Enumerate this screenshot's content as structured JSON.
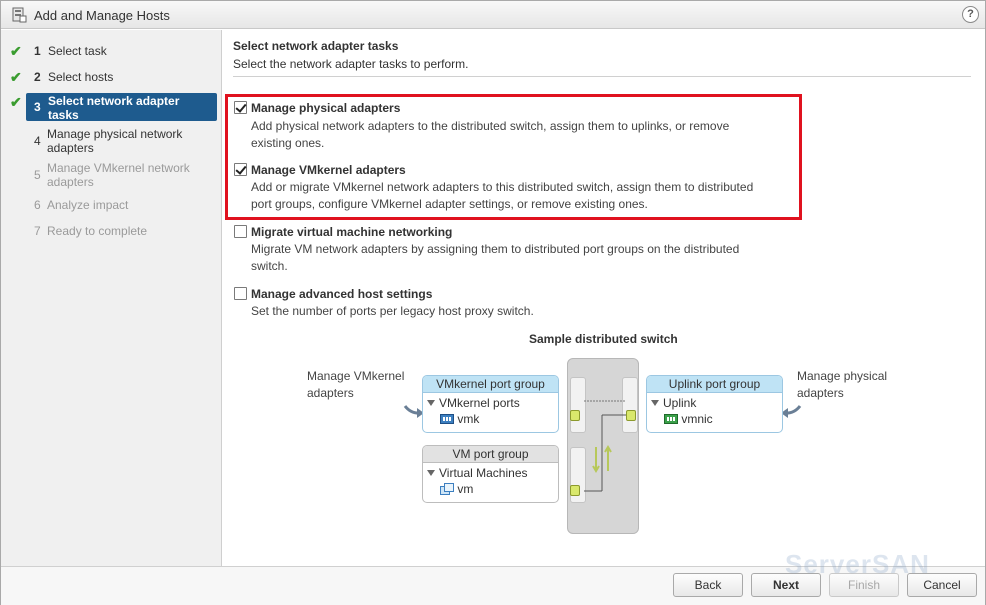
{
  "window": {
    "title": "Add and Manage Hosts",
    "help": "?"
  },
  "steps": [
    {
      "num": "1",
      "label": "Select task",
      "state": "done"
    },
    {
      "num": "2",
      "label": "Select hosts",
      "state": "done"
    },
    {
      "num": "3",
      "label": "Select network adapter tasks",
      "state": "active"
    },
    {
      "num": "4",
      "label": "Manage physical network adapters",
      "state": "enabled"
    },
    {
      "num": "5",
      "label": "Manage VMkernel network adapters",
      "state": "disabled"
    },
    {
      "num": "6",
      "label": "Analyze impact",
      "state": "disabled"
    },
    {
      "num": "7",
      "label": "Ready to complete",
      "state": "disabled"
    }
  ],
  "page": {
    "title": "Select network adapter tasks",
    "subtitle": "Select the network adapter tasks to perform."
  },
  "options": [
    {
      "label": "Manage physical adapters",
      "checked": true,
      "desc1": "Add physical network adapters to the distributed switch, assign them to uplinks, or remove",
      "desc2": "existing ones."
    },
    {
      "label": "Manage VMkernel adapters",
      "checked": true,
      "desc1": "Add or migrate VMkernel network adapters to this distributed switch, assign them to distributed",
      "desc2": "port groups, configure VMkernel adapter settings, or remove existing ones."
    },
    {
      "label": "Migrate virtual machine networking",
      "checked": false,
      "desc1": "Migrate VM network adapters by assigning them to distributed port groups on the distributed",
      "desc2": "switch."
    },
    {
      "label": "Manage advanced host settings",
      "checked": false,
      "desc1": "Set the number of ports per legacy host proxy switch.",
      "desc2": ""
    }
  ],
  "diagram": {
    "title": "Sample distributed switch",
    "left_label1": "Manage VMkernel",
    "left_label2": "adapters",
    "right_label1": "Manage physical",
    "right_label2": "adapters",
    "vmk_group": {
      "header": "VMkernel port group",
      "item": "VMkernel ports",
      "leaf": "vmk"
    },
    "vm_group": {
      "header": "VM port group",
      "item": "Virtual Machines",
      "leaf": "vm"
    },
    "uplink_group": {
      "header": "Uplink port group",
      "item": "Uplink",
      "leaf": "vmnic"
    }
  },
  "footer": {
    "back": "Back",
    "next": "Next",
    "finish": "Finish",
    "cancel": "Cancel"
  },
  "watermark": "ServerSAN",
  "colors": {
    "accent": "#1e5b8e",
    "check": "#3a9c2f",
    "highlight": "#e0121f"
  }
}
